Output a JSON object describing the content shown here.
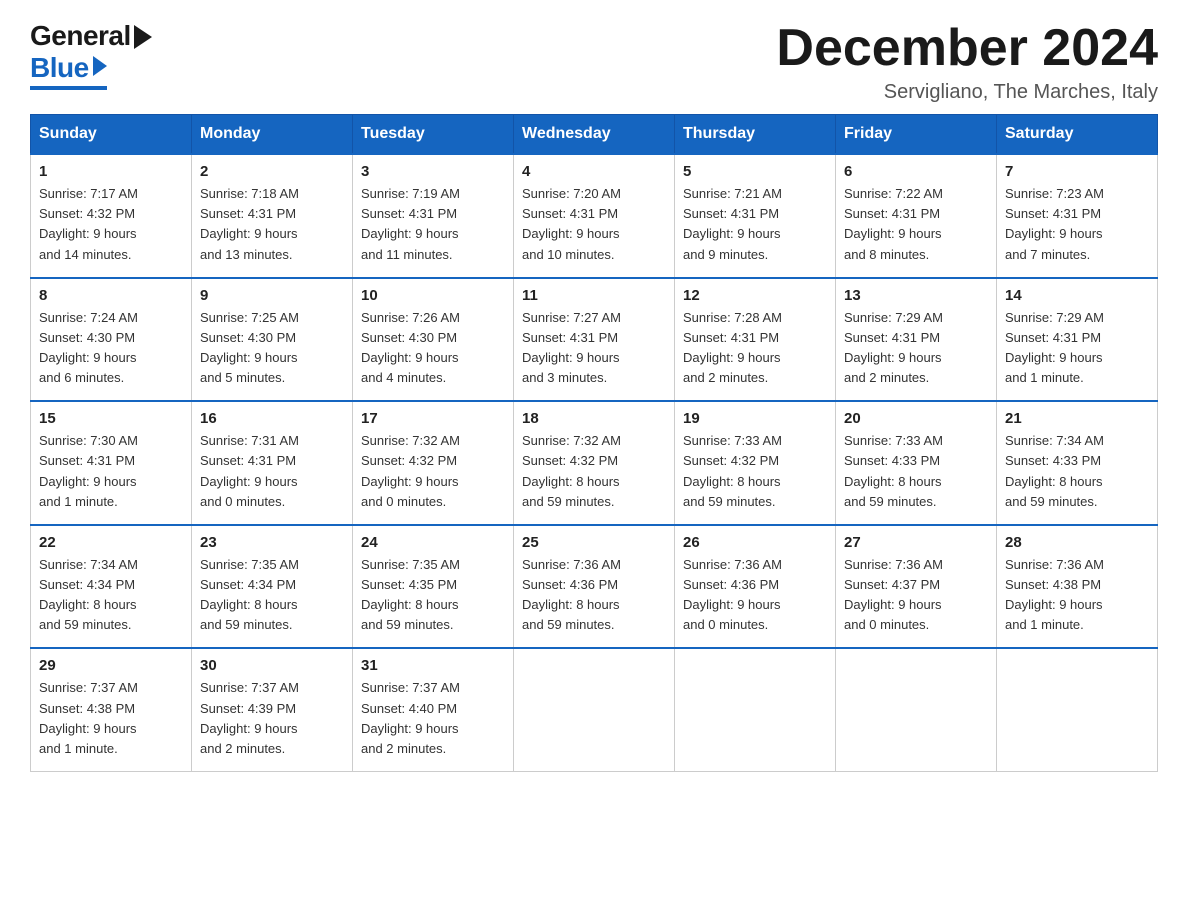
{
  "logo": {
    "general": "General",
    "blue": "Blue"
  },
  "title": "December 2024",
  "location": "Servigliano, The Marches, Italy",
  "days_header": [
    "Sunday",
    "Monday",
    "Tuesday",
    "Wednesday",
    "Thursday",
    "Friday",
    "Saturday"
  ],
  "weeks": [
    [
      {
        "day": "1",
        "info": "Sunrise: 7:17 AM\nSunset: 4:32 PM\nDaylight: 9 hours\nand 14 minutes."
      },
      {
        "day": "2",
        "info": "Sunrise: 7:18 AM\nSunset: 4:31 PM\nDaylight: 9 hours\nand 13 minutes."
      },
      {
        "day": "3",
        "info": "Sunrise: 7:19 AM\nSunset: 4:31 PM\nDaylight: 9 hours\nand 11 minutes."
      },
      {
        "day": "4",
        "info": "Sunrise: 7:20 AM\nSunset: 4:31 PM\nDaylight: 9 hours\nand 10 minutes."
      },
      {
        "day": "5",
        "info": "Sunrise: 7:21 AM\nSunset: 4:31 PM\nDaylight: 9 hours\nand 9 minutes."
      },
      {
        "day": "6",
        "info": "Sunrise: 7:22 AM\nSunset: 4:31 PM\nDaylight: 9 hours\nand 8 minutes."
      },
      {
        "day": "7",
        "info": "Sunrise: 7:23 AM\nSunset: 4:31 PM\nDaylight: 9 hours\nand 7 minutes."
      }
    ],
    [
      {
        "day": "8",
        "info": "Sunrise: 7:24 AM\nSunset: 4:30 PM\nDaylight: 9 hours\nand 6 minutes."
      },
      {
        "day": "9",
        "info": "Sunrise: 7:25 AM\nSunset: 4:30 PM\nDaylight: 9 hours\nand 5 minutes."
      },
      {
        "day": "10",
        "info": "Sunrise: 7:26 AM\nSunset: 4:30 PM\nDaylight: 9 hours\nand 4 minutes."
      },
      {
        "day": "11",
        "info": "Sunrise: 7:27 AM\nSunset: 4:31 PM\nDaylight: 9 hours\nand 3 minutes."
      },
      {
        "day": "12",
        "info": "Sunrise: 7:28 AM\nSunset: 4:31 PM\nDaylight: 9 hours\nand 2 minutes."
      },
      {
        "day": "13",
        "info": "Sunrise: 7:29 AM\nSunset: 4:31 PM\nDaylight: 9 hours\nand 2 minutes."
      },
      {
        "day": "14",
        "info": "Sunrise: 7:29 AM\nSunset: 4:31 PM\nDaylight: 9 hours\nand 1 minute."
      }
    ],
    [
      {
        "day": "15",
        "info": "Sunrise: 7:30 AM\nSunset: 4:31 PM\nDaylight: 9 hours\nand 1 minute."
      },
      {
        "day": "16",
        "info": "Sunrise: 7:31 AM\nSunset: 4:31 PM\nDaylight: 9 hours\nand 0 minutes."
      },
      {
        "day": "17",
        "info": "Sunrise: 7:32 AM\nSunset: 4:32 PM\nDaylight: 9 hours\nand 0 minutes."
      },
      {
        "day": "18",
        "info": "Sunrise: 7:32 AM\nSunset: 4:32 PM\nDaylight: 8 hours\nand 59 minutes."
      },
      {
        "day": "19",
        "info": "Sunrise: 7:33 AM\nSunset: 4:32 PM\nDaylight: 8 hours\nand 59 minutes."
      },
      {
        "day": "20",
        "info": "Sunrise: 7:33 AM\nSunset: 4:33 PM\nDaylight: 8 hours\nand 59 minutes."
      },
      {
        "day": "21",
        "info": "Sunrise: 7:34 AM\nSunset: 4:33 PM\nDaylight: 8 hours\nand 59 minutes."
      }
    ],
    [
      {
        "day": "22",
        "info": "Sunrise: 7:34 AM\nSunset: 4:34 PM\nDaylight: 8 hours\nand 59 minutes."
      },
      {
        "day": "23",
        "info": "Sunrise: 7:35 AM\nSunset: 4:34 PM\nDaylight: 8 hours\nand 59 minutes."
      },
      {
        "day": "24",
        "info": "Sunrise: 7:35 AM\nSunset: 4:35 PM\nDaylight: 8 hours\nand 59 minutes."
      },
      {
        "day": "25",
        "info": "Sunrise: 7:36 AM\nSunset: 4:36 PM\nDaylight: 8 hours\nand 59 minutes."
      },
      {
        "day": "26",
        "info": "Sunrise: 7:36 AM\nSunset: 4:36 PM\nDaylight: 9 hours\nand 0 minutes."
      },
      {
        "day": "27",
        "info": "Sunrise: 7:36 AM\nSunset: 4:37 PM\nDaylight: 9 hours\nand 0 minutes."
      },
      {
        "day": "28",
        "info": "Sunrise: 7:36 AM\nSunset: 4:38 PM\nDaylight: 9 hours\nand 1 minute."
      }
    ],
    [
      {
        "day": "29",
        "info": "Sunrise: 7:37 AM\nSunset: 4:38 PM\nDaylight: 9 hours\nand 1 minute."
      },
      {
        "day": "30",
        "info": "Sunrise: 7:37 AM\nSunset: 4:39 PM\nDaylight: 9 hours\nand 2 minutes."
      },
      {
        "day": "31",
        "info": "Sunrise: 7:37 AM\nSunset: 4:40 PM\nDaylight: 9 hours\nand 2 minutes."
      },
      {
        "day": "",
        "info": ""
      },
      {
        "day": "",
        "info": ""
      },
      {
        "day": "",
        "info": ""
      },
      {
        "day": "",
        "info": ""
      }
    ]
  ]
}
